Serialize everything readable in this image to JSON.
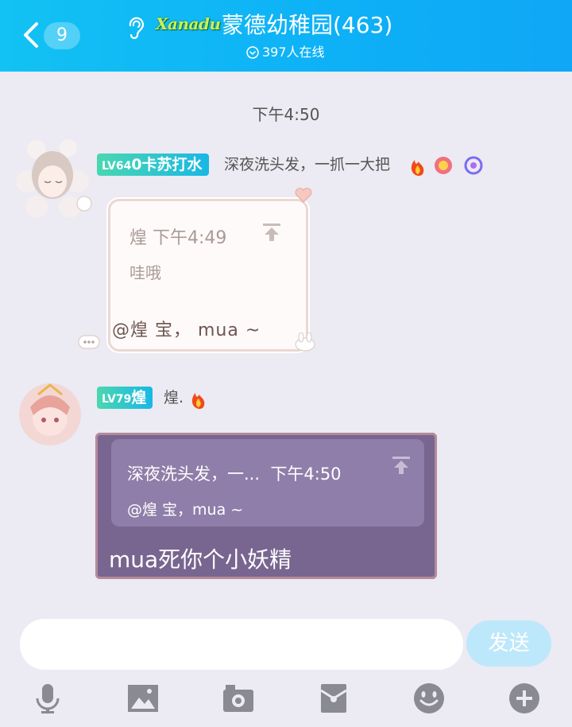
{
  "header": {
    "unread_count": "9",
    "logo_text": "Xanadu",
    "title": "蒙德幼稚园(463)",
    "online": "397人在线"
  },
  "messages": [
    {
      "time_separator": "下午4:50"
    },
    {
      "level": "LV64",
      "level_name": "0卡苏打水",
      "nickname": "深夜洗头发，一抓一大把",
      "quote": {
        "author": "煌",
        "time": "下午4:49",
        "text": "哇哦"
      },
      "text": "@煌 宝， mua ~"
    },
    {
      "level": "LV79",
      "level_name": "煌",
      "nickname": "煌.",
      "quote": {
        "author": "深夜洗头发，一...",
        "time": "下午4:50",
        "text": "@煌 宝，mua ~"
      },
      "text": "mua死你个小妖精"
    }
  ],
  "composer": {
    "placeholder": "",
    "send_label": "发送"
  },
  "toolbar": [
    "microphone-icon",
    "image-icon",
    "camera-icon",
    "red-packet-icon",
    "emoji-icon",
    "plus-icon"
  ],
  "colors": {
    "header": "#0eb0f6",
    "background": "#eceaf2",
    "send_disabled": "#bde8fb",
    "bubble2": "#786590",
    "toolbar_icon": "#8a8a92"
  }
}
